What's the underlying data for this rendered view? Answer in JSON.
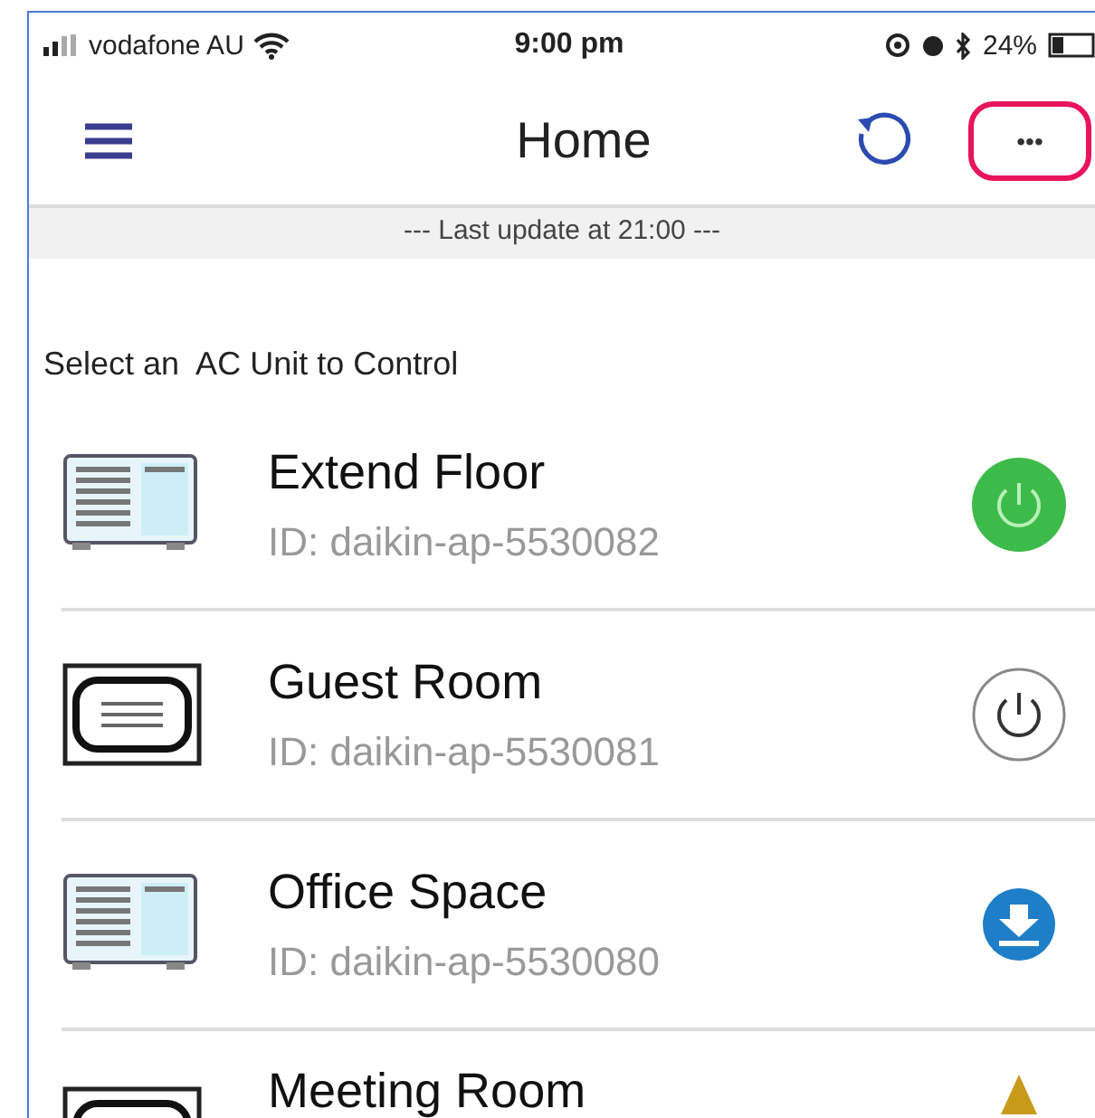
{
  "status_bar": {
    "carrier": "vodafone AU",
    "time": "9:00 pm",
    "battery": "24%"
  },
  "nav": {
    "title": "Home",
    "more": "•••",
    "more_highlighted": true
  },
  "update_banner": "--- Last update at 21:00 ---",
  "prompt": "Select an  AC Unit to Control",
  "units": [
    {
      "name": "Extend Floor",
      "id": "ID: daikin-ap-5530082",
      "kind": "wall",
      "status": {
        "kind": "on"
      }
    },
    {
      "name": "Guest Room",
      "id": "ID: daikin-ap-5530081",
      "kind": "ducted",
      "status": {
        "kind": "off"
      }
    },
    {
      "name": "Office Space",
      "id": "ID: daikin-ap-5530080",
      "kind": "wall",
      "status": {
        "kind": "update"
      }
    },
    {
      "name": "Meeting Room",
      "kind": "ducted",
      "status": {
        "kind": "warning"
      }
    }
  ]
}
